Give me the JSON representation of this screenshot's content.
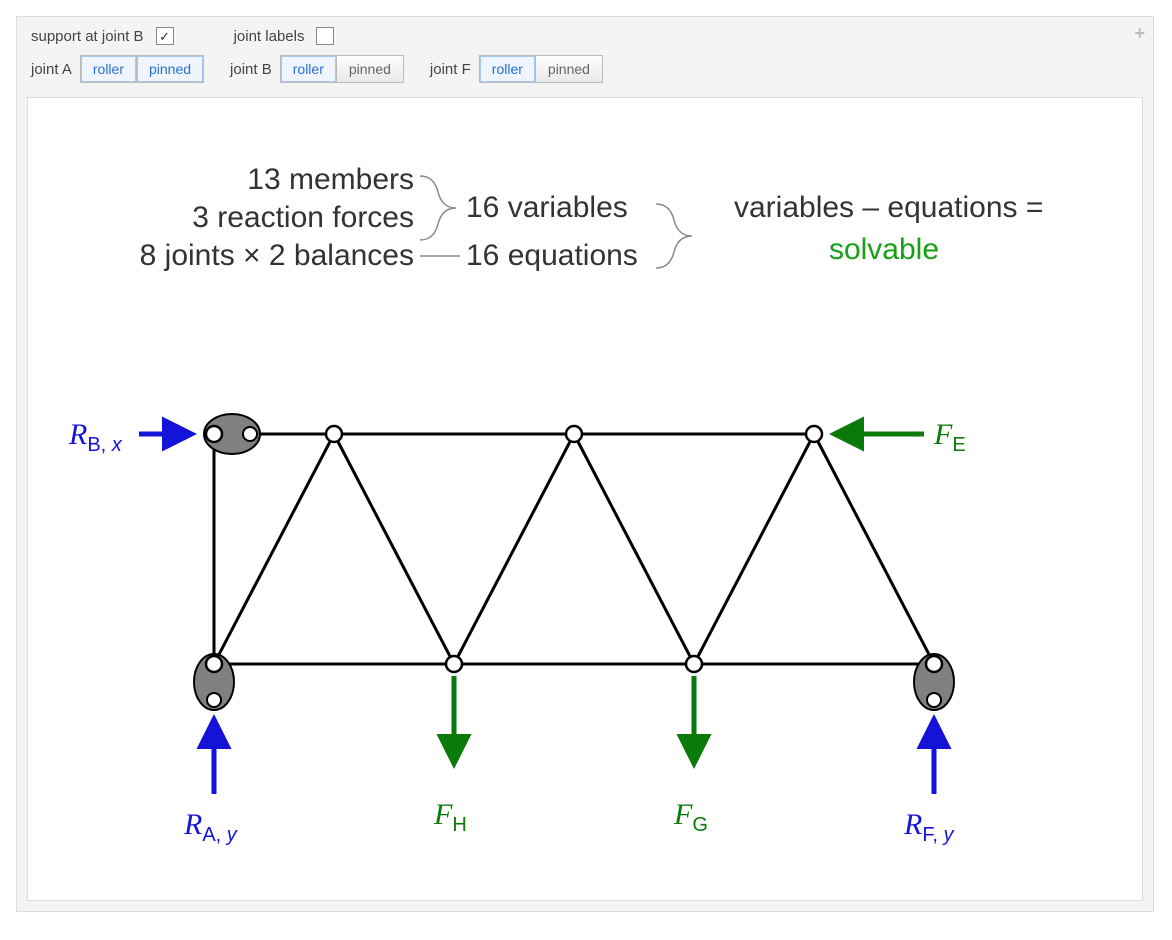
{
  "controls": {
    "supportAtB": {
      "label": "support at joint B",
      "checked": true
    },
    "jointLabels": {
      "label": "joint labels",
      "checked": false
    },
    "jointA": {
      "label": "joint A",
      "options": [
        "roller",
        "pinned"
      ],
      "selected": "roller"
    },
    "jointB": {
      "label": "joint B",
      "options": [
        "roller",
        "pinned"
      ],
      "selected": "roller"
    },
    "jointF": {
      "label": "joint F",
      "options": [
        "roller",
        "pinned"
      ],
      "selected": "roller"
    }
  },
  "summary": {
    "members": "13 members",
    "reactions": "3 reaction forces",
    "joints": "8 joints × 2 balances",
    "variables": "16 variables",
    "equations": "16 equations",
    "varsMinusEq": "variables – equations =",
    "result": "solvable"
  },
  "chart_data": {
    "type": "diagram",
    "truss_joints": {
      "A": {
        "x": 0,
        "y": 0,
        "support": "roller",
        "reaction": "R_A,y"
      },
      "B": {
        "x": 0,
        "y": 1,
        "support": "roller",
        "reaction": "R_B,x"
      },
      "C": {
        "x": 1,
        "y": 1
      },
      "D": {
        "x": 2,
        "y": 1
      },
      "E": {
        "x": 3,
        "y": 1,
        "load": "F_E",
        "dir": "-x"
      },
      "F": {
        "x": 4,
        "y": 0,
        "support": "roller",
        "reaction": "R_F,y"
      },
      "G": {
        "x": 3,
        "y": 0,
        "load": "F_G",
        "dir": "-y"
      },
      "H": {
        "x": 1,
        "y": 0,
        "load": "F_H",
        "dir": "-y"
      }
    },
    "members": 13,
    "reaction_forces": 3,
    "joints": 8,
    "variables": 16,
    "equations": 16,
    "result": "solvable"
  },
  "forces": {
    "RBx": "R",
    "RBx_sub": "B, ",
    "RBx_sub_i": "x",
    "RAy": "R",
    "RAy_sub": "A, ",
    "RAy_sub_i": "y",
    "RFy": "R",
    "RFy_sub": "F, ",
    "RFy_sub_i": "y",
    "FE": "F",
    "FE_sub": "E",
    "FH": "F",
    "FH_sub": "H",
    "FG": "F",
    "FG_sub": "G"
  }
}
